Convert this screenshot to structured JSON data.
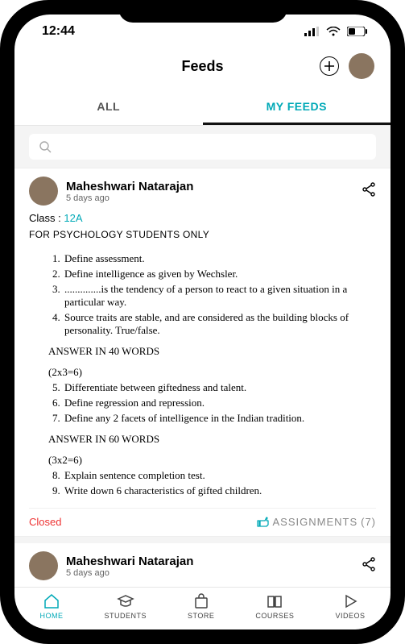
{
  "status": {
    "time": "12:44"
  },
  "header": {
    "title": "Feeds"
  },
  "tabs": {
    "all": "ALL",
    "my": "MY FEEDS"
  },
  "search": {
    "placeholder": ""
  },
  "feed": {
    "author": "Maheshwari Natarajan",
    "time": "5 days ago",
    "class_label": "Class :",
    "class_code": "12A",
    "doc_title": "FOR PSYCHOLOGY STUDENTS ONLY",
    "q1": "Define assessment.",
    "q2": "Define intelligence as given by Wechsler.",
    "q3": "..............is the tendency of a person to react to a given situation in a particular way.",
    "q4": "Source traits are stable, and are considered as the building blocks of personality. True/false.",
    "section2a": "ANSWER IN 40 WORDS",
    "section2b": "(2x3=6)",
    "q5": "Differentiate between giftedness and talent.",
    "q6": "Define regression and repression.",
    "q7": " Define any 2 facets of intelligence in the Indian tradition.",
    "section3a": "ANSWER IN 60 WORDS",
    "section3b": "(3x2=6)",
    "q8": "Explain sentence completion test.",
    "q9": "Write down 6 characteristics of gifted children.",
    "closed": "Closed",
    "assign_label": "ASSIGNMENTS",
    "assign_count": "(7)"
  },
  "feed2": {
    "author": "Maheshwari Natarajan",
    "time": "5 days ago"
  },
  "nav": {
    "home": "HOME",
    "students": "STUDENTS",
    "store": "STORE",
    "courses": "COURSES",
    "videos": "VIDEOS"
  }
}
